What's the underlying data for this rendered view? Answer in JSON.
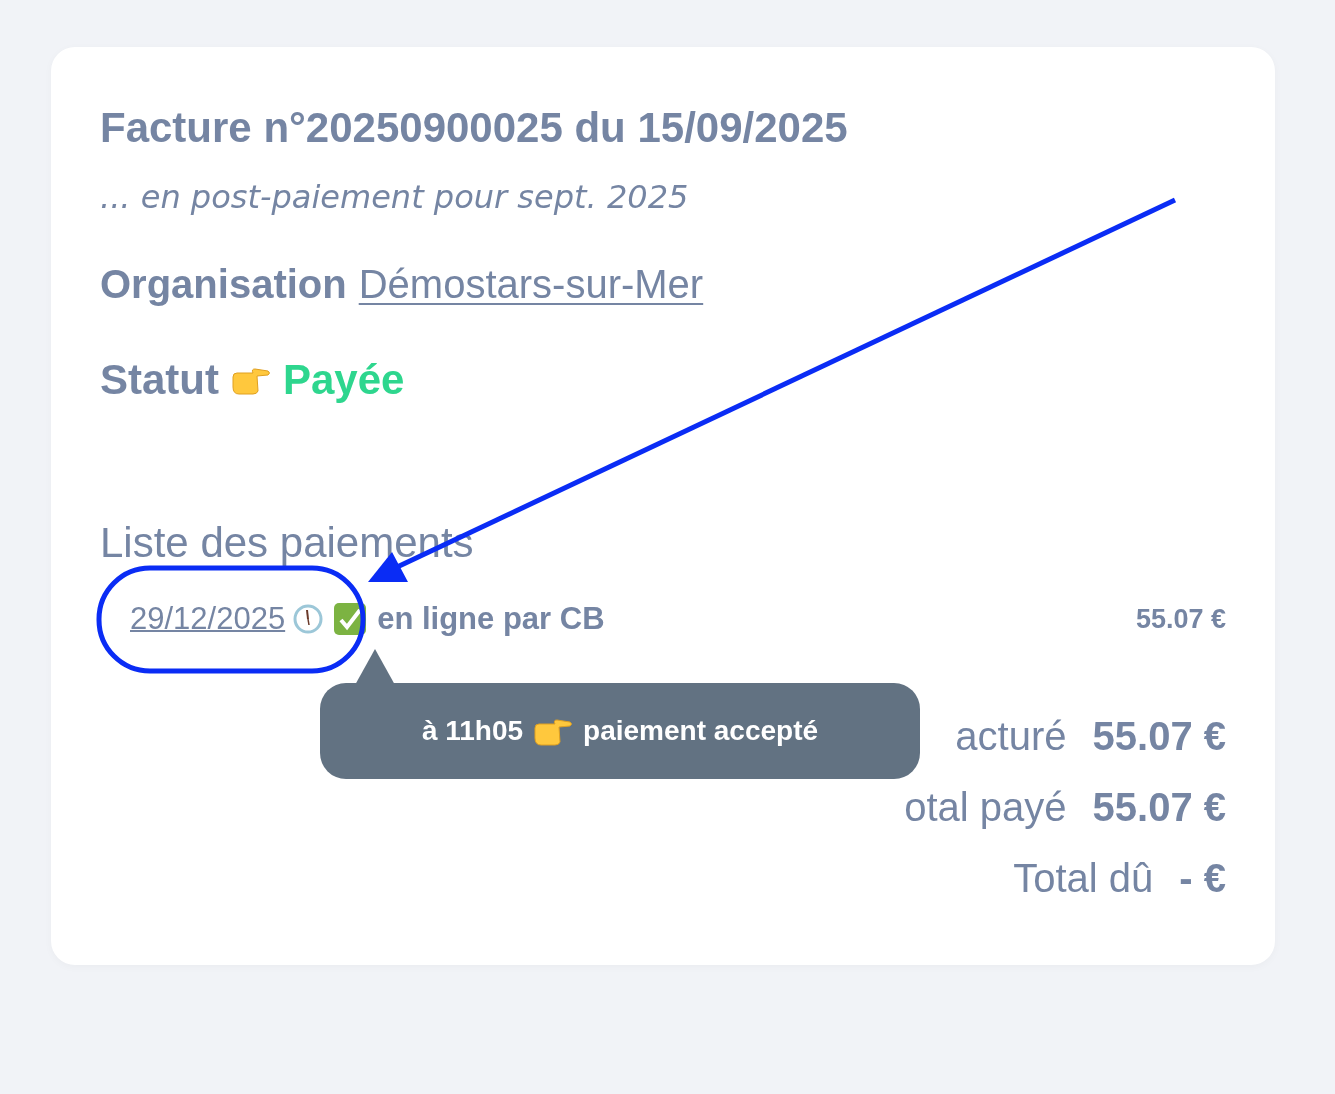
{
  "invoice": {
    "title": "Facture n°**20250900025** du 15/09/2025",
    "subtitle": "... en post-paiement pour sept. 2025",
    "organisation": {
      "label": "Organisation",
      "value": "Démostars-sur-Mer"
    },
    "status": {
      "label": "Statut",
      "value": "Payée",
      "paid": true
    }
  },
  "payments": {
    "heading": "Liste des paiements",
    "items": [
      {
        "date": "29/12/2025",
        "succeeded": true,
        "method": "en ligne par CB",
        "amount": "55.07 €"
      }
    ]
  },
  "tooltip": {
    "time": "à 11h05",
    "text": "paiement accepté"
  },
  "totals": [
    {
      "label": "acturé",
      "value": "55.07 €"
    },
    {
      "label": "otal payé",
      "value": "55.07 €"
    },
    {
      "label": "Total dû",
      "value": "- €"
    }
  ]
}
